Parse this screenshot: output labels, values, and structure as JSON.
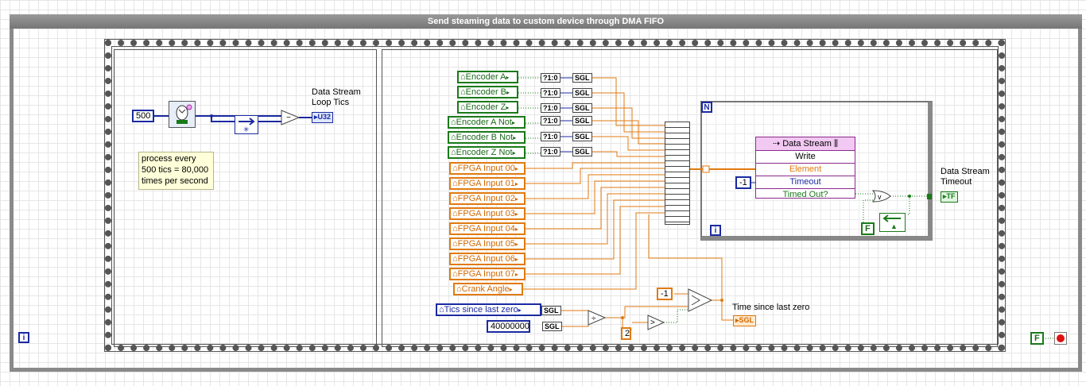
{
  "header": {
    "title": "Send steaming data to custom device through DMA FIFO"
  },
  "left_pane": {
    "constant_500": "500",
    "note": [
      "process every",
      "500 tics = 80,000",
      "times per second"
    ],
    "indicator_label": [
      "Data Stream",
      "Loop Tics"
    ],
    "indicator_type": "U32",
    "iteration_terminal": "i"
  },
  "inputs": {
    "green": [
      "Encoder A",
      "Encoder B",
      "Encoder Z",
      "Encoder A Not",
      "Encoder B Not",
      "Encoder Z Not"
    ],
    "orange": [
      "FPGA Input 00",
      "FPGA Input 01",
      "FPGA Input 02",
      "FPGA Input 03",
      "FPGA Input 04",
      "FPGA Input 05",
      "FPGA Input 06",
      "FPGA Input 07"
    ],
    "crank": "Crank Angle",
    "tics": "Tics since last zero",
    "const_40000000": "40000000",
    "const_neg1_lower": "-1",
    "const_2": "2"
  },
  "conversions": {
    "bool_to_num": "?1:0",
    "sgl": "SGL"
  },
  "fifo": {
    "title": "Data Stream",
    "rows": [
      "Write",
      "Element",
      "Timeout",
      "Timed Out?"
    ],
    "timeout_const": "-1"
  },
  "for_loop": {
    "count": "N",
    "iteration": "i"
  },
  "outputs": {
    "timeout_label": [
      "Data Stream",
      "Timeout"
    ],
    "timeout_type": "TF",
    "time_label": "Time since last zero",
    "time_type": "SGL",
    "false_const": "F"
  },
  "stop": {
    "false_const": "F"
  },
  "colors": {
    "green": "#1a7a1a",
    "orange": "#e07a10",
    "blue": "#1a2aa0",
    "purple": "#8b2a8b",
    "frame": "#8a8a8a"
  }
}
